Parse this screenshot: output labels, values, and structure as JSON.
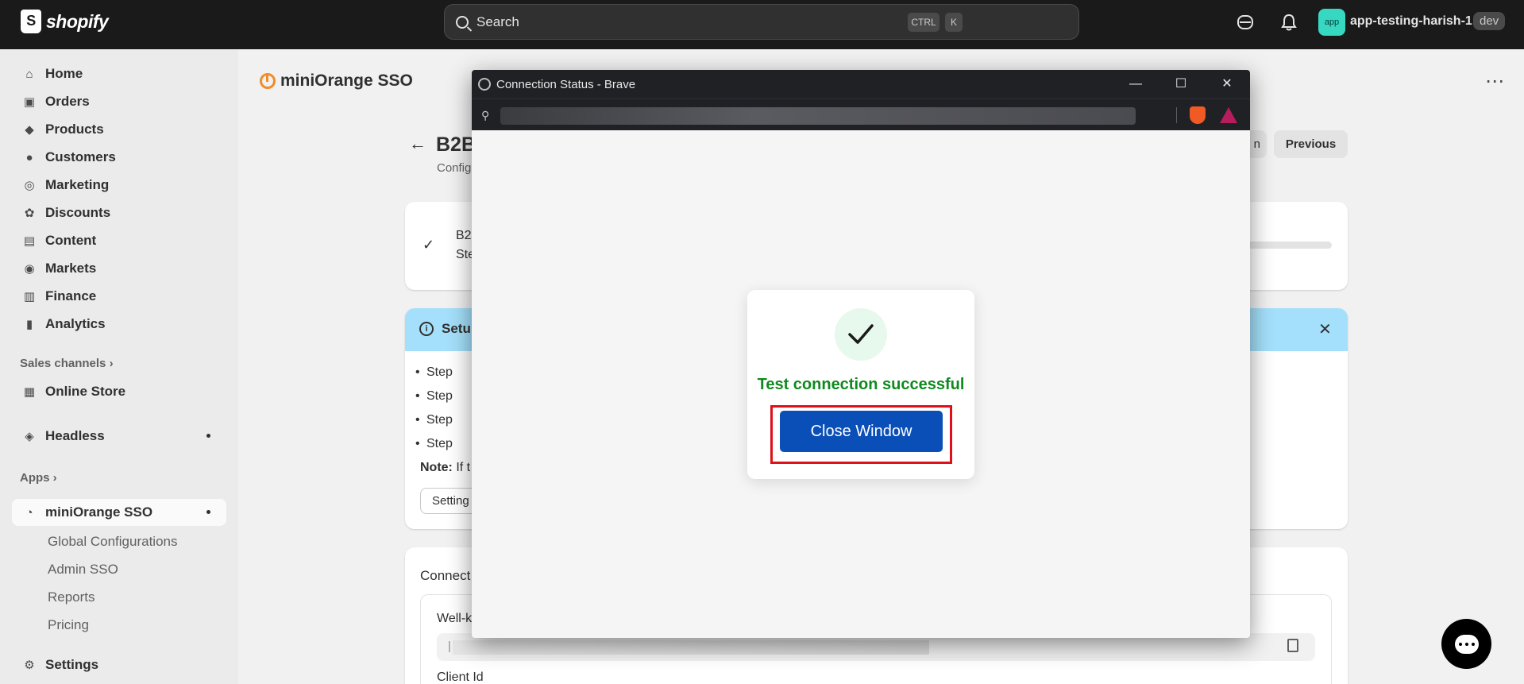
{
  "topbar": {
    "logo_text": "shopify",
    "search_placeholder": "Search",
    "kbd_ctrl": "CTRL",
    "kbd_k": "K",
    "store_avatar": "app",
    "store_name": "app-testing-harish-1",
    "store_badge": "dev"
  },
  "sidebar": {
    "items": [
      {
        "label": "Home",
        "icon": "home-icon"
      },
      {
        "label": "Orders",
        "icon": "inbox-icon"
      },
      {
        "label": "Products",
        "icon": "tag-icon"
      },
      {
        "label": "Customers",
        "icon": "person-icon"
      },
      {
        "label": "Marketing",
        "icon": "target-icon"
      },
      {
        "label": "Discounts",
        "icon": "discount-icon"
      },
      {
        "label": "Content",
        "icon": "image-icon"
      },
      {
        "label": "Markets",
        "icon": "globe-icon"
      },
      {
        "label": "Finance",
        "icon": "bank-icon"
      },
      {
        "label": "Analytics",
        "icon": "chart-icon"
      }
    ],
    "sales_channels_label": "Sales channels",
    "online_store": "Online Store",
    "headless": "Headless",
    "apps_label": "Apps",
    "app_name": "miniOrange SSO",
    "app_sub_items": [
      "Global Configurations",
      "Admin SSO",
      "Reports",
      "Pricing"
    ],
    "settings": "Settings"
  },
  "main": {
    "app_title": "miniOrange SSO",
    "page_title": "B2B",
    "page_subtitle": "Config",
    "previous_button": "Previous",
    "partial_button": "n",
    "status_line1": "B2",
    "status_line2": "Ste",
    "banner_title": "Setup",
    "bullets": [
      "Step",
      "Step",
      "Step",
      "Step"
    ],
    "note_label": "Note:",
    "note_text": " If t",
    "settings_button": "Setting",
    "connection_label": "Connect",
    "well_known_label": "Well-k",
    "field_cursor": "|",
    "client_id_label": "Client Id"
  },
  "popup": {
    "window_title": "Connection Status - Brave",
    "success_message": "Test connection successful",
    "close_button": "Close Window",
    "colors": {
      "success": "#0f8a1e",
      "button": "#0a4fb8",
      "highlight": "#e0101a"
    }
  }
}
